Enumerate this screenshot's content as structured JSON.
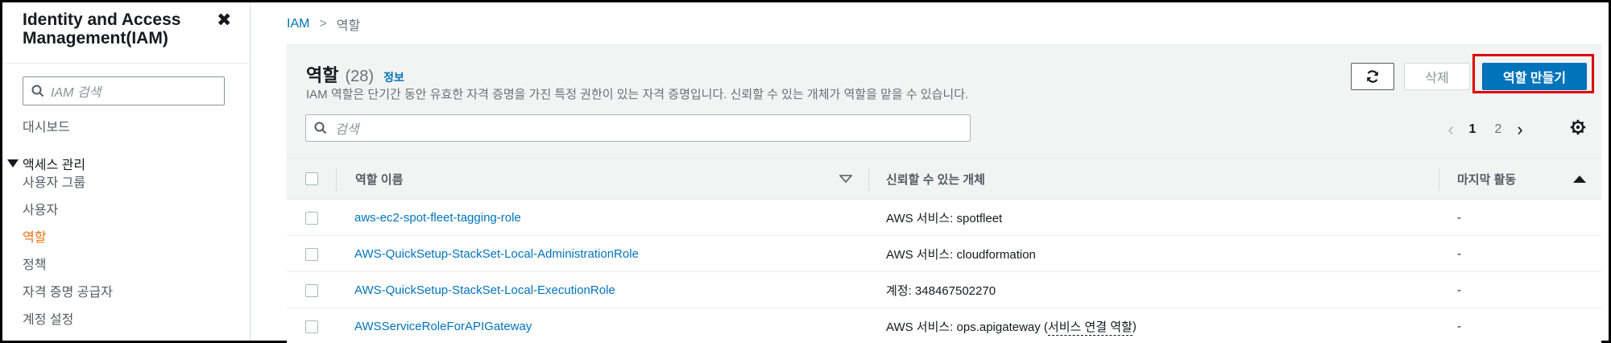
{
  "sidebar": {
    "title": "Identity and Access Management(IAM)",
    "close_icon": "close-icon",
    "search_placeholder": "IAM 검색",
    "dashboard": "대시보드",
    "section_label": "액세스 관리",
    "items": [
      {
        "label": "사용자 그룹",
        "active": false
      },
      {
        "label": "사용자",
        "active": false
      },
      {
        "label": "역할",
        "active": true
      },
      {
        "label": "정책",
        "active": false
      },
      {
        "label": "자격 증명 공급자",
        "active": false
      },
      {
        "label": "계정 설정",
        "active": false
      }
    ],
    "active_color": "#ec7211"
  },
  "breadcrumb": {
    "root": "IAM",
    "current": "역할"
  },
  "header": {
    "title": "역할",
    "count": "(28)",
    "info_link": "정보",
    "description": "IAM 역할은 단기간 동안 유효한 자격 증명을 가진 특정 권한이 있는 자격 증명입니다. 신뢰할 수 있는 개체가 역할을 맡을 수 있습니다.",
    "refresh_icon": "refresh-icon",
    "delete_label": "삭제",
    "create_label": "역할 만들기",
    "primary_color": "#0073bb"
  },
  "table_search": {
    "placeholder": "검색"
  },
  "pagination": {
    "pages": [
      "1",
      "2"
    ],
    "current_page": "1"
  },
  "table": {
    "columns": [
      "역할 이름",
      "신뢰할 수 있는 개체",
      "마지막 활동"
    ],
    "rows": [
      {
        "name": "aws-ec2-spot-fleet-tagging-role",
        "trusted": "AWS 서비스: spotfleet",
        "trusted_suffix": "",
        "last": "-"
      },
      {
        "name": "AWS-QuickSetup-StackSet-Local-AdministrationRole",
        "trusted": "AWS 서비스: cloudformation",
        "trusted_suffix": "",
        "last": "-"
      },
      {
        "name": "AWS-QuickSetup-StackSet-Local-ExecutionRole",
        "trusted": "계정: 348467502270",
        "trusted_suffix": "",
        "last": "-"
      },
      {
        "name": "AWSServiceRoleForAPIGateway",
        "trusted": "AWS 서비스: ops.apigateway (",
        "trusted_suffix": "서비스 연결 역할",
        "trusted_end": ")",
        "last": "-"
      }
    ]
  }
}
